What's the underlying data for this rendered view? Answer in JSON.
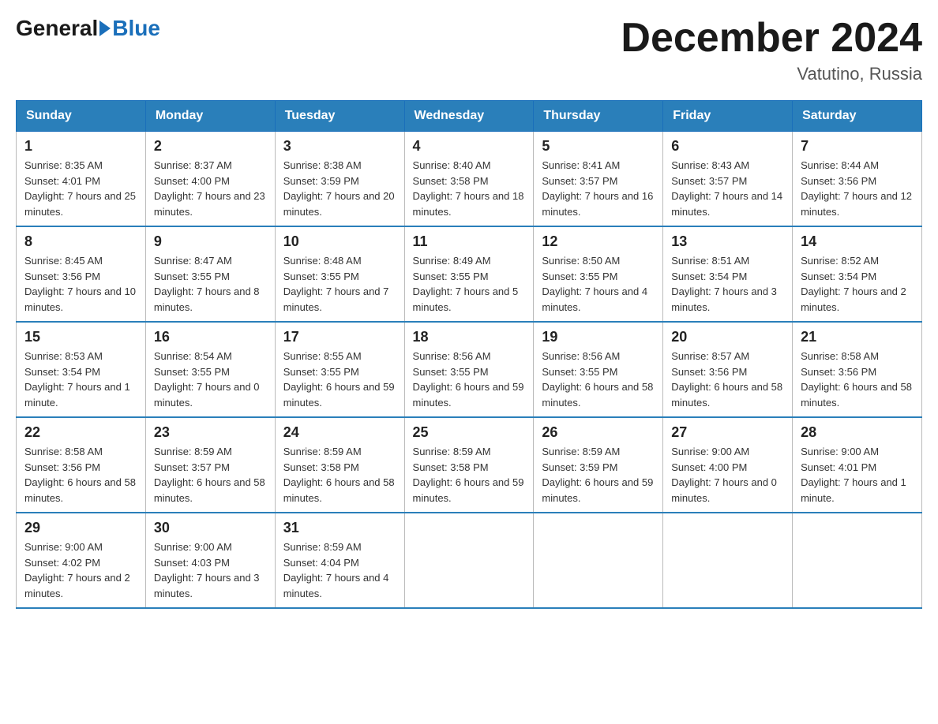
{
  "header": {
    "logo": {
      "general": "General",
      "blue": "Blue"
    },
    "title": "December 2024",
    "location": "Vatutino, Russia"
  },
  "calendar": {
    "days_of_week": [
      "Sunday",
      "Monday",
      "Tuesday",
      "Wednesday",
      "Thursday",
      "Friday",
      "Saturday"
    ],
    "weeks": [
      [
        {
          "day": 1,
          "sunrise": "Sunrise: 8:35 AM",
          "sunset": "Sunset: 4:01 PM",
          "daylight": "Daylight: 7 hours and 25 minutes."
        },
        {
          "day": 2,
          "sunrise": "Sunrise: 8:37 AM",
          "sunset": "Sunset: 4:00 PM",
          "daylight": "Daylight: 7 hours and 23 minutes."
        },
        {
          "day": 3,
          "sunrise": "Sunrise: 8:38 AM",
          "sunset": "Sunset: 3:59 PM",
          "daylight": "Daylight: 7 hours and 20 minutes."
        },
        {
          "day": 4,
          "sunrise": "Sunrise: 8:40 AM",
          "sunset": "Sunset: 3:58 PM",
          "daylight": "Daylight: 7 hours and 18 minutes."
        },
        {
          "day": 5,
          "sunrise": "Sunrise: 8:41 AM",
          "sunset": "Sunset: 3:57 PM",
          "daylight": "Daylight: 7 hours and 16 minutes."
        },
        {
          "day": 6,
          "sunrise": "Sunrise: 8:43 AM",
          "sunset": "Sunset: 3:57 PM",
          "daylight": "Daylight: 7 hours and 14 minutes."
        },
        {
          "day": 7,
          "sunrise": "Sunrise: 8:44 AM",
          "sunset": "Sunset: 3:56 PM",
          "daylight": "Daylight: 7 hours and 12 minutes."
        }
      ],
      [
        {
          "day": 8,
          "sunrise": "Sunrise: 8:45 AM",
          "sunset": "Sunset: 3:56 PM",
          "daylight": "Daylight: 7 hours and 10 minutes."
        },
        {
          "day": 9,
          "sunrise": "Sunrise: 8:47 AM",
          "sunset": "Sunset: 3:55 PM",
          "daylight": "Daylight: 7 hours and 8 minutes."
        },
        {
          "day": 10,
          "sunrise": "Sunrise: 8:48 AM",
          "sunset": "Sunset: 3:55 PM",
          "daylight": "Daylight: 7 hours and 7 minutes."
        },
        {
          "day": 11,
          "sunrise": "Sunrise: 8:49 AM",
          "sunset": "Sunset: 3:55 PM",
          "daylight": "Daylight: 7 hours and 5 minutes."
        },
        {
          "day": 12,
          "sunrise": "Sunrise: 8:50 AM",
          "sunset": "Sunset: 3:55 PM",
          "daylight": "Daylight: 7 hours and 4 minutes."
        },
        {
          "day": 13,
          "sunrise": "Sunrise: 8:51 AM",
          "sunset": "Sunset: 3:54 PM",
          "daylight": "Daylight: 7 hours and 3 minutes."
        },
        {
          "day": 14,
          "sunrise": "Sunrise: 8:52 AM",
          "sunset": "Sunset: 3:54 PM",
          "daylight": "Daylight: 7 hours and 2 minutes."
        }
      ],
      [
        {
          "day": 15,
          "sunrise": "Sunrise: 8:53 AM",
          "sunset": "Sunset: 3:54 PM",
          "daylight": "Daylight: 7 hours and 1 minute."
        },
        {
          "day": 16,
          "sunrise": "Sunrise: 8:54 AM",
          "sunset": "Sunset: 3:55 PM",
          "daylight": "Daylight: 7 hours and 0 minutes."
        },
        {
          "day": 17,
          "sunrise": "Sunrise: 8:55 AM",
          "sunset": "Sunset: 3:55 PM",
          "daylight": "Daylight: 6 hours and 59 minutes."
        },
        {
          "day": 18,
          "sunrise": "Sunrise: 8:56 AM",
          "sunset": "Sunset: 3:55 PM",
          "daylight": "Daylight: 6 hours and 59 minutes."
        },
        {
          "day": 19,
          "sunrise": "Sunrise: 8:56 AM",
          "sunset": "Sunset: 3:55 PM",
          "daylight": "Daylight: 6 hours and 58 minutes."
        },
        {
          "day": 20,
          "sunrise": "Sunrise: 8:57 AM",
          "sunset": "Sunset: 3:56 PM",
          "daylight": "Daylight: 6 hours and 58 minutes."
        },
        {
          "day": 21,
          "sunrise": "Sunrise: 8:58 AM",
          "sunset": "Sunset: 3:56 PM",
          "daylight": "Daylight: 6 hours and 58 minutes."
        }
      ],
      [
        {
          "day": 22,
          "sunrise": "Sunrise: 8:58 AM",
          "sunset": "Sunset: 3:56 PM",
          "daylight": "Daylight: 6 hours and 58 minutes."
        },
        {
          "day": 23,
          "sunrise": "Sunrise: 8:59 AM",
          "sunset": "Sunset: 3:57 PM",
          "daylight": "Daylight: 6 hours and 58 minutes."
        },
        {
          "day": 24,
          "sunrise": "Sunrise: 8:59 AM",
          "sunset": "Sunset: 3:58 PM",
          "daylight": "Daylight: 6 hours and 58 minutes."
        },
        {
          "day": 25,
          "sunrise": "Sunrise: 8:59 AM",
          "sunset": "Sunset: 3:58 PM",
          "daylight": "Daylight: 6 hours and 59 minutes."
        },
        {
          "day": 26,
          "sunrise": "Sunrise: 8:59 AM",
          "sunset": "Sunset: 3:59 PM",
          "daylight": "Daylight: 6 hours and 59 minutes."
        },
        {
          "day": 27,
          "sunrise": "Sunrise: 9:00 AM",
          "sunset": "Sunset: 4:00 PM",
          "daylight": "Daylight: 7 hours and 0 minutes."
        },
        {
          "day": 28,
          "sunrise": "Sunrise: 9:00 AM",
          "sunset": "Sunset: 4:01 PM",
          "daylight": "Daylight: 7 hours and 1 minute."
        }
      ],
      [
        {
          "day": 29,
          "sunrise": "Sunrise: 9:00 AM",
          "sunset": "Sunset: 4:02 PM",
          "daylight": "Daylight: 7 hours and 2 minutes."
        },
        {
          "day": 30,
          "sunrise": "Sunrise: 9:00 AM",
          "sunset": "Sunset: 4:03 PM",
          "daylight": "Daylight: 7 hours and 3 minutes."
        },
        {
          "day": 31,
          "sunrise": "Sunrise: 8:59 AM",
          "sunset": "Sunset: 4:04 PM",
          "daylight": "Daylight: 7 hours and 4 minutes."
        },
        null,
        null,
        null,
        null
      ]
    ]
  }
}
